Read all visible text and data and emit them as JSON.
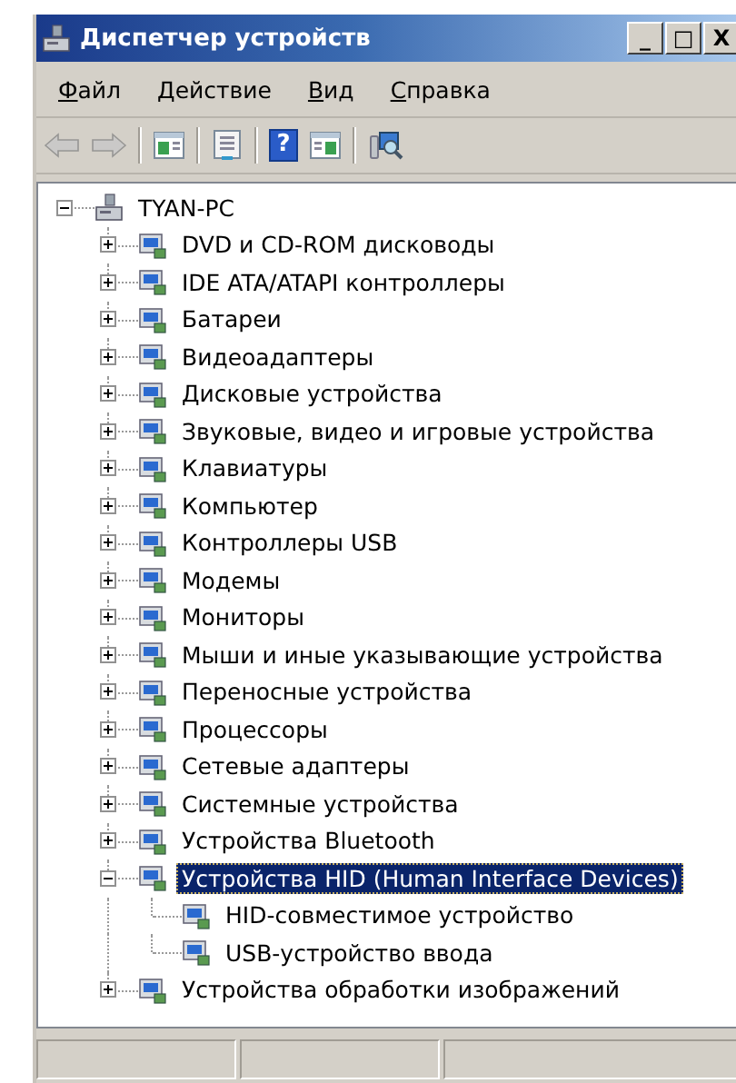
{
  "window": {
    "title": "Диспетчер устройств",
    "controls": [
      "_",
      "□",
      "X"
    ]
  },
  "menu": [
    {
      "label": "Файл"
    },
    {
      "label": "Действие"
    },
    {
      "label": "Вид"
    },
    {
      "label": "Справка"
    }
  ],
  "toolbar": [
    {
      "kind": "back",
      "disabled": true
    },
    {
      "kind": "forward",
      "disabled": true
    },
    {
      "kind": "separator"
    },
    {
      "kind": "tree",
      "disabled": false
    },
    {
      "kind": "separator"
    },
    {
      "kind": "properties",
      "disabled": false
    },
    {
      "kind": "separator"
    },
    {
      "kind": "help",
      "label": "?",
      "disabled": false
    },
    {
      "kind": "pane",
      "disabled": false
    },
    {
      "kind": "separator"
    },
    {
      "kind": "scan",
      "disabled": false
    }
  ],
  "tree": {
    "label": "TYAN-PC",
    "expanded": true,
    "selected": false,
    "children": [
      {
        "label": "DVD и CD-ROM дисководы",
        "expanded": false,
        "selected": false
      },
      {
        "label": "IDE ATA/ATAPI контроллеры",
        "expanded": false,
        "selected": false
      },
      {
        "label": "Батареи",
        "expanded": false,
        "selected": false
      },
      {
        "label": "Видеоадаптеры",
        "expanded": false,
        "selected": false
      },
      {
        "label": "Дисковые устройства",
        "expanded": false,
        "selected": false
      },
      {
        "label": "Звуковые, видео и игровые устройства",
        "expanded": false,
        "selected": false
      },
      {
        "label": "Клавиатуры",
        "expanded": false,
        "selected": false
      },
      {
        "label": "Компьютер",
        "expanded": false,
        "selected": false
      },
      {
        "label": "Контроллеры USB",
        "expanded": false,
        "selected": false
      },
      {
        "label": "Модемы",
        "expanded": false,
        "selected": false
      },
      {
        "label": "Мониторы",
        "expanded": false,
        "selected": false
      },
      {
        "label": "Мыши и иные указывающие устройства",
        "expanded": false,
        "selected": false
      },
      {
        "label": "Переносные устройства",
        "expanded": false,
        "selected": false
      },
      {
        "label": "Процессоры",
        "expanded": false,
        "selected": false
      },
      {
        "label": "Сетевые адаптеры",
        "expanded": false,
        "selected": false
      },
      {
        "label": "Системные устройства",
        "expanded": false,
        "selected": false
      },
      {
        "label": "Устройства Bluetooth",
        "expanded": false,
        "selected": false
      },
      {
        "label": "Устройства HID (Human Interface Devices)",
        "expanded": true,
        "selected": true,
        "children": [
          {
            "label": "HID-совместимое устройство",
            "selected": false
          },
          {
            "label": "USB-устройство ввода",
            "selected": false
          }
        ]
      },
      {
        "label": "Устройства обработки изображений",
        "expanded": false,
        "selected": false
      }
    ]
  }
}
